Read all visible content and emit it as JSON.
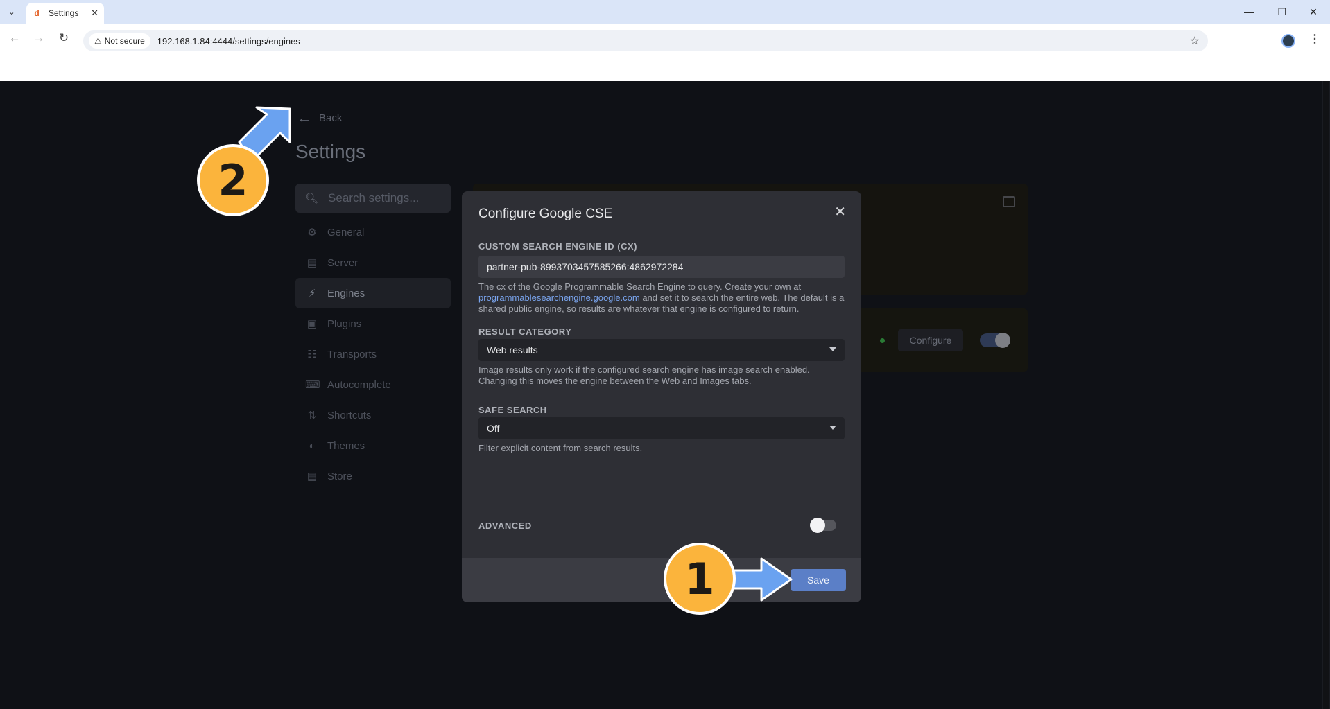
{
  "browser": {
    "tab_title": "Settings",
    "favicon_glyph": "d",
    "security_label": "Not secure",
    "url": "192.168.1.84:4444/settings/engines"
  },
  "sidebar": {
    "back_label": "Back",
    "title": "Settings",
    "search_placeholder": "Search settings...",
    "items": [
      {
        "label": "General",
        "icon": "gear-icon"
      },
      {
        "label": "Server",
        "icon": "server-icon"
      },
      {
        "label": "Engines",
        "icon": "lightning-icon",
        "active": true
      },
      {
        "label": "Plugins",
        "icon": "puzzle-icon"
      },
      {
        "label": "Transports",
        "icon": "network-icon"
      },
      {
        "label": "Autocomplete",
        "icon": "keyboard-icon"
      },
      {
        "label": "Shortcuts",
        "icon": "sort-icon"
      },
      {
        "label": "Themes",
        "icon": "palette-icon"
      },
      {
        "label": "Store",
        "icon": "store-icon"
      }
    ]
  },
  "background": {
    "configure_label": "Configure"
  },
  "modal": {
    "title": "Configure Google CSE",
    "cx_label": "CUSTOM SEARCH ENGINE ID (CX)",
    "cx_value": "partner-pub-8993703457585266:4862972284",
    "cx_help_1": "The cx of the Google Programmable Search Engine to query. Create your own at ",
    "cx_help_link": "programmablesearchengine.google.com",
    "cx_help_2": " and set it to search the entire web. The default is a shared public engine, so results are whatever that engine is configured to return.",
    "category_label": "RESULT CATEGORY",
    "category_value": "Web results",
    "category_help": "Image results only work if the configured search engine has image search enabled. Changing this moves the engine between the Web and Images tabs.",
    "safe_label": "SAFE SEARCH",
    "safe_value": "Off",
    "safe_help": "Filter explicit content from search results.",
    "advanced_label": "ADVANCED",
    "advanced_on": false,
    "save_label": "Save"
  },
  "annotations": {
    "step1": "1",
    "step2": "2",
    "badge_color": "#fbb43c",
    "arrow_color": "#6aa2f0"
  }
}
